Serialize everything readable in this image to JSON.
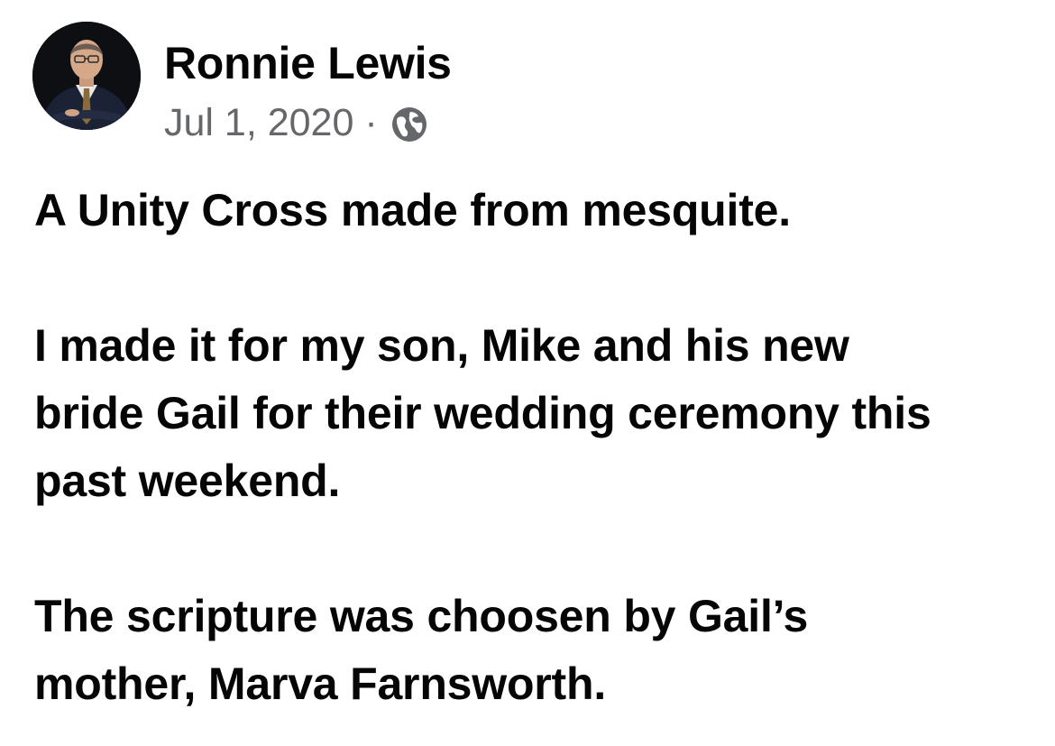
{
  "post": {
    "author": {
      "name": "Ronnie Lewis",
      "avatar": "profile-photo"
    },
    "date": "Jul 1, 2020",
    "separator": "·",
    "privacy_icon": "globe-icon",
    "paragraphs": [
      "A Unity Cross made from mesquite.",
      "I made it for my son, Mike and his new\nbride Gail for their wedding ceremony this\npast weekend.",
      "The scripture was choosen by Gail’s\nmother, Marva Farnsworth."
    ]
  },
  "colors": {
    "text_primary": "#050505",
    "text_secondary": "#65676b",
    "background": "#ffffff"
  }
}
